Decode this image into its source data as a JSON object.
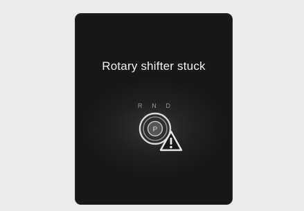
{
  "display": {
    "message": "Rotary shifter stuck",
    "gears": [
      "R",
      "N",
      "D"
    ],
    "knob_icon": "rotary-shifter-knob-icon",
    "knob_indicator": "P",
    "warning_icon": "warning-triangle-icon"
  }
}
